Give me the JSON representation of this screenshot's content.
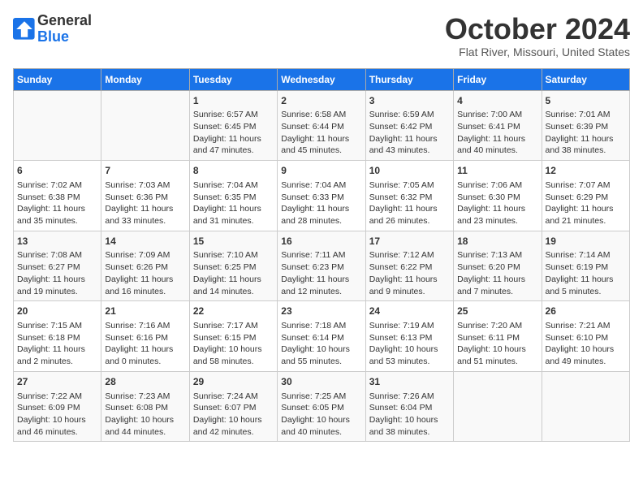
{
  "header": {
    "logo_line1": "General",
    "logo_line2": "Blue",
    "month_title": "October 2024",
    "location": "Flat River, Missouri, United States"
  },
  "days_of_week": [
    "Sunday",
    "Monday",
    "Tuesday",
    "Wednesday",
    "Thursday",
    "Friday",
    "Saturday"
  ],
  "weeks": [
    [
      {
        "day": "",
        "info": ""
      },
      {
        "day": "",
        "info": ""
      },
      {
        "day": "1",
        "info": "Sunrise: 6:57 AM\nSunset: 6:45 PM\nDaylight: 11 hours and 47 minutes."
      },
      {
        "day": "2",
        "info": "Sunrise: 6:58 AM\nSunset: 6:44 PM\nDaylight: 11 hours and 45 minutes."
      },
      {
        "day": "3",
        "info": "Sunrise: 6:59 AM\nSunset: 6:42 PM\nDaylight: 11 hours and 43 minutes."
      },
      {
        "day": "4",
        "info": "Sunrise: 7:00 AM\nSunset: 6:41 PM\nDaylight: 11 hours and 40 minutes."
      },
      {
        "day": "5",
        "info": "Sunrise: 7:01 AM\nSunset: 6:39 PM\nDaylight: 11 hours and 38 minutes."
      }
    ],
    [
      {
        "day": "6",
        "info": "Sunrise: 7:02 AM\nSunset: 6:38 PM\nDaylight: 11 hours and 35 minutes."
      },
      {
        "day": "7",
        "info": "Sunrise: 7:03 AM\nSunset: 6:36 PM\nDaylight: 11 hours and 33 minutes."
      },
      {
        "day": "8",
        "info": "Sunrise: 7:04 AM\nSunset: 6:35 PM\nDaylight: 11 hours and 31 minutes."
      },
      {
        "day": "9",
        "info": "Sunrise: 7:04 AM\nSunset: 6:33 PM\nDaylight: 11 hours and 28 minutes."
      },
      {
        "day": "10",
        "info": "Sunrise: 7:05 AM\nSunset: 6:32 PM\nDaylight: 11 hours and 26 minutes."
      },
      {
        "day": "11",
        "info": "Sunrise: 7:06 AM\nSunset: 6:30 PM\nDaylight: 11 hours and 23 minutes."
      },
      {
        "day": "12",
        "info": "Sunrise: 7:07 AM\nSunset: 6:29 PM\nDaylight: 11 hours and 21 minutes."
      }
    ],
    [
      {
        "day": "13",
        "info": "Sunrise: 7:08 AM\nSunset: 6:27 PM\nDaylight: 11 hours and 19 minutes."
      },
      {
        "day": "14",
        "info": "Sunrise: 7:09 AM\nSunset: 6:26 PM\nDaylight: 11 hours and 16 minutes."
      },
      {
        "day": "15",
        "info": "Sunrise: 7:10 AM\nSunset: 6:25 PM\nDaylight: 11 hours and 14 minutes."
      },
      {
        "day": "16",
        "info": "Sunrise: 7:11 AM\nSunset: 6:23 PM\nDaylight: 11 hours and 12 minutes."
      },
      {
        "day": "17",
        "info": "Sunrise: 7:12 AM\nSunset: 6:22 PM\nDaylight: 11 hours and 9 minutes."
      },
      {
        "day": "18",
        "info": "Sunrise: 7:13 AM\nSunset: 6:20 PM\nDaylight: 11 hours and 7 minutes."
      },
      {
        "day": "19",
        "info": "Sunrise: 7:14 AM\nSunset: 6:19 PM\nDaylight: 11 hours and 5 minutes."
      }
    ],
    [
      {
        "day": "20",
        "info": "Sunrise: 7:15 AM\nSunset: 6:18 PM\nDaylight: 11 hours and 2 minutes."
      },
      {
        "day": "21",
        "info": "Sunrise: 7:16 AM\nSunset: 6:16 PM\nDaylight: 11 hours and 0 minutes."
      },
      {
        "day": "22",
        "info": "Sunrise: 7:17 AM\nSunset: 6:15 PM\nDaylight: 10 hours and 58 minutes."
      },
      {
        "day": "23",
        "info": "Sunrise: 7:18 AM\nSunset: 6:14 PM\nDaylight: 10 hours and 55 minutes."
      },
      {
        "day": "24",
        "info": "Sunrise: 7:19 AM\nSunset: 6:13 PM\nDaylight: 10 hours and 53 minutes."
      },
      {
        "day": "25",
        "info": "Sunrise: 7:20 AM\nSunset: 6:11 PM\nDaylight: 10 hours and 51 minutes."
      },
      {
        "day": "26",
        "info": "Sunrise: 7:21 AM\nSunset: 6:10 PM\nDaylight: 10 hours and 49 minutes."
      }
    ],
    [
      {
        "day": "27",
        "info": "Sunrise: 7:22 AM\nSunset: 6:09 PM\nDaylight: 10 hours and 46 minutes."
      },
      {
        "day": "28",
        "info": "Sunrise: 7:23 AM\nSunset: 6:08 PM\nDaylight: 10 hours and 44 minutes."
      },
      {
        "day": "29",
        "info": "Sunrise: 7:24 AM\nSunset: 6:07 PM\nDaylight: 10 hours and 42 minutes."
      },
      {
        "day": "30",
        "info": "Sunrise: 7:25 AM\nSunset: 6:05 PM\nDaylight: 10 hours and 40 minutes."
      },
      {
        "day": "31",
        "info": "Sunrise: 7:26 AM\nSunset: 6:04 PM\nDaylight: 10 hours and 38 minutes."
      },
      {
        "day": "",
        "info": ""
      },
      {
        "day": "",
        "info": ""
      }
    ]
  ]
}
